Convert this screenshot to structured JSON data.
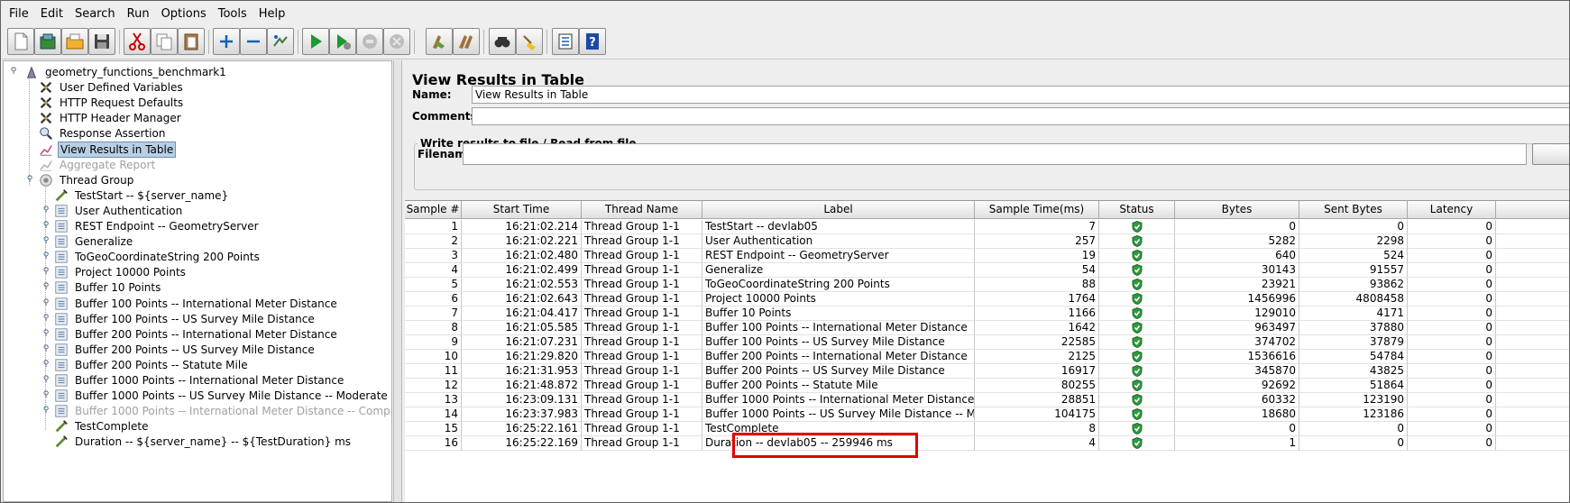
{
  "menu": [
    "File",
    "Edit",
    "Search",
    "Run",
    "Options",
    "Tools",
    "Help"
  ],
  "toolbar_icons": [
    "new-icon",
    "templates-icon",
    "open-icon",
    "save-icon",
    "cut-icon",
    "copy-icon",
    "paste-icon",
    "expand-icon",
    "collapse-icon",
    "toggle-icon",
    "start-icon",
    "start-no-pauses-icon",
    "stop-icon",
    "shutdown-icon",
    "clear-icon",
    "clear-all-icon",
    "search-icon",
    "reset-search-icon",
    "function-helper-icon",
    "help-icon"
  ],
  "tree": [
    {
      "label": "geometry_functions_benchmark1",
      "icon": "test-plan-icon"
    },
    {
      "label": "User Defined Variables",
      "icon": "config-icon"
    },
    {
      "label": "HTTP Request Defaults",
      "icon": "config-icon"
    },
    {
      "label": "HTTP Header Manager",
      "icon": "config-icon"
    },
    {
      "label": "Response Assertion",
      "icon": "assertion-icon"
    },
    {
      "label": "View Results in Table",
      "icon": "listener-icon"
    },
    {
      "label": "Aggregate Report",
      "icon": "report-icon"
    },
    {
      "label": "Thread Group",
      "icon": "thread-group-icon"
    },
    {
      "label": "TestStart -- ${server_name}",
      "icon": "sampler-icon"
    },
    {
      "label": "User Authentication",
      "icon": "controller-icon"
    },
    {
      "label": "REST Endpoint -- GeometryServer",
      "icon": "controller-icon"
    },
    {
      "label": "Generalize",
      "icon": "controller-icon"
    },
    {
      "label": "ToGeoCoordinateString 200 Points",
      "icon": "controller-icon"
    },
    {
      "label": "Project 10000 Points",
      "icon": "controller-icon"
    },
    {
      "label": "Buffer 10 Points",
      "icon": "controller-icon"
    },
    {
      "label": "Buffer 100 Points -- International Meter Distance",
      "icon": "controller-icon"
    },
    {
      "label": "Buffer 100 Points -- US Survey Mile Distance",
      "icon": "controller-icon"
    },
    {
      "label": "Buffer 200 Points -- International Meter Distance",
      "icon": "controller-icon"
    },
    {
      "label": "Buffer 200 Points -- US Survey Mile Distance",
      "icon": "controller-icon"
    },
    {
      "label": "Buffer 200 Points -- Statute Mile",
      "icon": "controller-icon"
    },
    {
      "label": "Buffer 1000 Points -- International Meter Distance",
      "icon": "controller-icon"
    },
    {
      "label": "Buffer 1000 Points -- US Survey Mile Distance -- Moderate",
      "icon": "controller-icon"
    },
    {
      "label": "Buffer 1000 Points -- International Meter Distance -- Complex",
      "icon": "controller-icon"
    },
    {
      "label": "TestComplete",
      "icon": "sampler-icon"
    },
    {
      "label": "Duration -- ${server_name} -- ${TestDuration} ms",
      "icon": "sampler-icon"
    }
  ],
  "panel": {
    "title": "View Results in Table",
    "name_label": "Name:",
    "name_value": "View Results in Table",
    "comments_label": "Comments:",
    "comments_value": "",
    "write_results_title": "Write results to file / Read from file",
    "filename_label": "Filename",
    "filename_value": ""
  },
  "table": {
    "columns": [
      "Sample #",
      "Start Time",
      "Thread Name",
      "Label",
      "Sample Time(ms)",
      "Status",
      "Bytes",
      "Sent Bytes",
      "Latency"
    ],
    "rows": [
      [
        "1",
        "16:21:02.214",
        "Thread Group 1-1",
        "TestStart -- devlab05",
        "7",
        "success",
        "0",
        "0",
        "0"
      ],
      [
        "2",
        "16:21:02.221",
        "Thread Group 1-1",
        "User Authentication",
        "257",
        "success",
        "5282",
        "2298",
        "0"
      ],
      [
        "3",
        "16:21:02.480",
        "Thread Group 1-1",
        "REST Endpoint -- GeometryServer",
        "19",
        "success",
        "640",
        "524",
        "0"
      ],
      [
        "4",
        "16:21:02.499",
        "Thread Group 1-1",
        "Generalize",
        "54",
        "success",
        "30143",
        "91557",
        "0"
      ],
      [
        "5",
        "16:21:02.553",
        "Thread Group 1-1",
        "ToGeoCoordinateString 200 Points",
        "88",
        "success",
        "23921",
        "93862",
        "0"
      ],
      [
        "6",
        "16:21:02.643",
        "Thread Group 1-1",
        "Project 10000 Points",
        "1764",
        "success",
        "1456996",
        "4808458",
        "0"
      ],
      [
        "7",
        "16:21:04.417",
        "Thread Group 1-1",
        "Buffer 10 Points",
        "1166",
        "success",
        "129010",
        "4171",
        "0"
      ],
      [
        "8",
        "16:21:05.585",
        "Thread Group 1-1",
        "Buffer 100 Points -- International Meter Distance",
        "1642",
        "success",
        "963497",
        "37880",
        "0"
      ],
      [
        "9",
        "16:21:07.231",
        "Thread Group 1-1",
        "Buffer 100 Points -- US Survey Mile Distance",
        "22585",
        "success",
        "374702",
        "37879",
        "0"
      ],
      [
        "10",
        "16:21:29.820",
        "Thread Group 1-1",
        "Buffer 200 Points -- International Meter Distance",
        "2125",
        "success",
        "1536616",
        "54784",
        "0"
      ],
      [
        "11",
        "16:21:31.953",
        "Thread Group 1-1",
        "Buffer 200 Points -- US Survey Mile Distance",
        "16917",
        "success",
        "345870",
        "43825",
        "0"
      ],
      [
        "12",
        "16:21:48.872",
        "Thread Group 1-1",
        "Buffer 200 Points -- Statute Mile",
        "80255",
        "success",
        "92692",
        "51864",
        "0"
      ],
      [
        "13",
        "16:23:09.131",
        "Thread Group 1-1",
        "Buffer 1000 Points -- International Meter Distance",
        "28851",
        "success",
        "60332",
        "123190",
        "0"
      ],
      [
        "14",
        "16:23:37.983",
        "Thread Group 1-1",
        "Buffer 1000 Points -- US Survey Mile Distance -- Moderate",
        "104175",
        "success",
        "18680",
        "123186",
        "0"
      ],
      [
        "15",
        "16:25:22.161",
        "Thread Group 1-1",
        "TestComplete",
        "8",
        "success",
        "0",
        "0",
        "0"
      ],
      [
        "16",
        "16:25:22.169",
        "Thread Group 1-1",
        "Duration -- devlab05 -- 259946 ms",
        "4",
        "success",
        "1",
        "0",
        "0"
      ]
    ]
  },
  "colors": {
    "selection": "#b8cfe5",
    "success": "#2e9b3e",
    "highlight": "#e00000"
  }
}
